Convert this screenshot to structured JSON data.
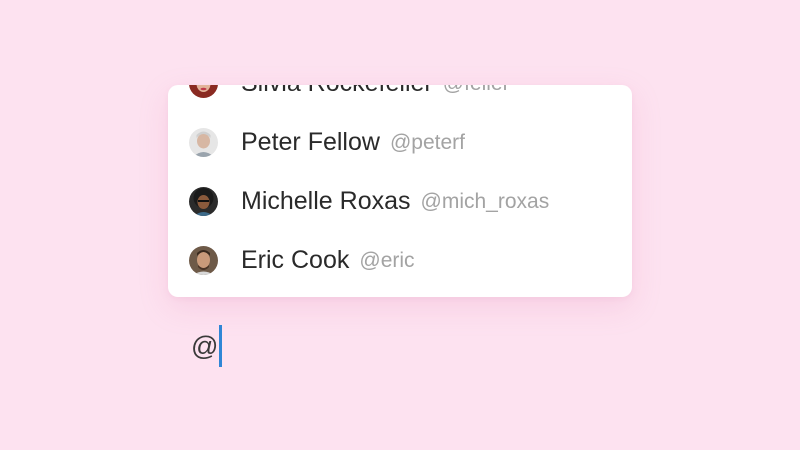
{
  "mentions": [
    {
      "name": "Silvia Rockefeller",
      "handle": "@feller",
      "avatar": "silvia-avatar"
    },
    {
      "name": "Peter Fellow",
      "handle": "@peterf",
      "avatar": "peter-avatar"
    },
    {
      "name": "Michelle Roxas",
      "handle": "@mich_roxas",
      "avatar": "michelle-avatar"
    },
    {
      "name": "Eric Cook",
      "handle": "@eric",
      "avatar": "eric-avatar"
    }
  ],
  "composer": {
    "text": "@"
  },
  "colors": {
    "background": "#fde2f0",
    "caret": "#2f86d6",
    "handle": "#a3a3a3"
  }
}
